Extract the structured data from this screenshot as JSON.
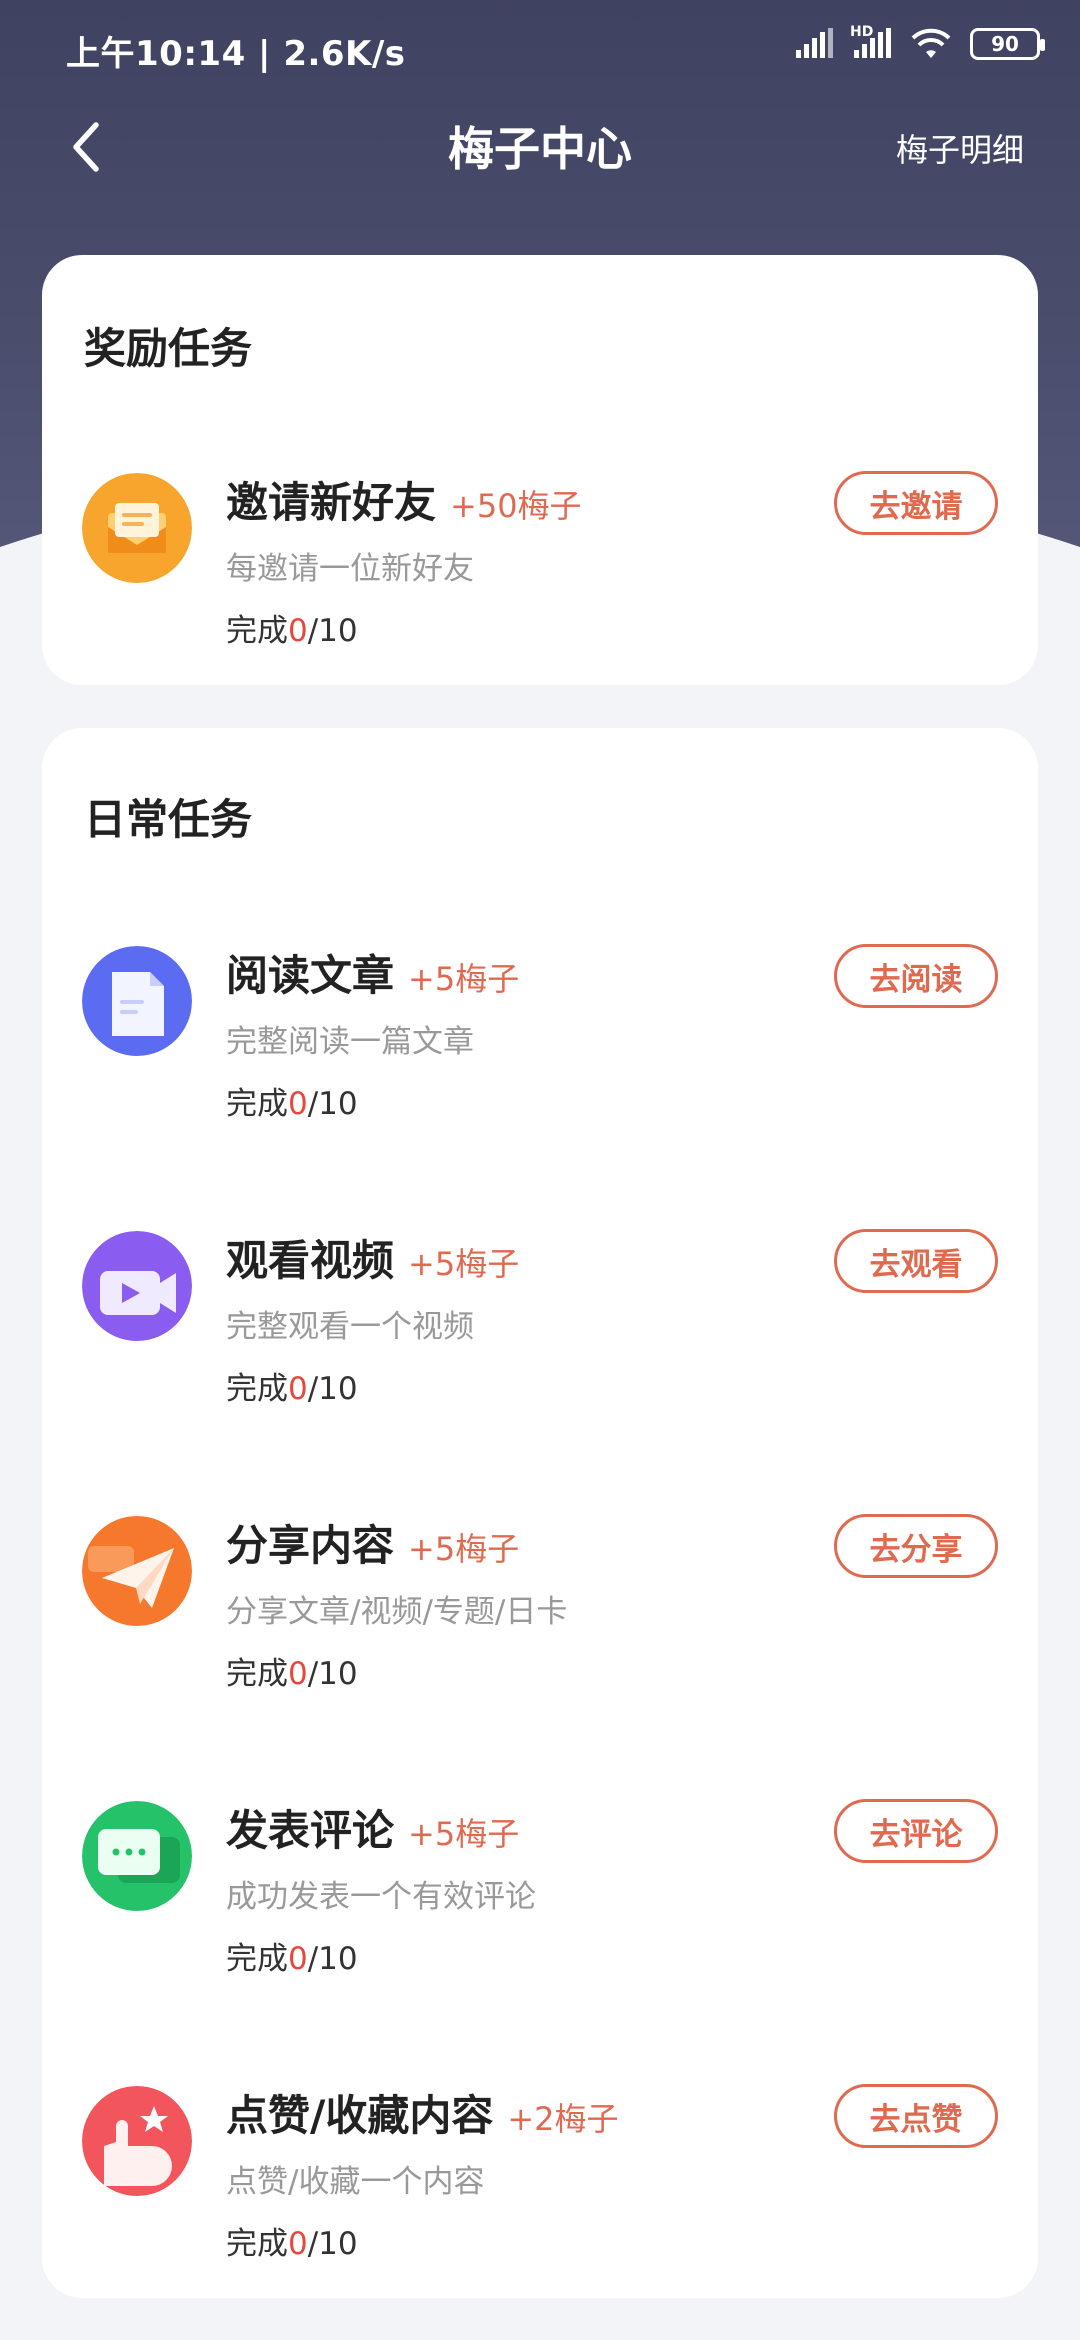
{
  "status_bar": {
    "time_speed": "上午10:14 | 2.6K/s",
    "hd": "HD",
    "battery": "90"
  },
  "nav": {
    "title": "梅子中心",
    "detail_link": "梅子明细"
  },
  "reward_section": {
    "title": "奖励任务",
    "tasks": [
      {
        "name": "邀请新好友",
        "reward": "+50梅子",
        "desc": "每邀请一位新好友",
        "progress_label": "完成",
        "progress_done": "0",
        "progress_total": "/10",
        "button": "去邀请",
        "icon": "envelope-icon",
        "color": "#f7a52c"
      }
    ]
  },
  "daily_section": {
    "title": "日常任务",
    "tasks": [
      {
        "name": "阅读文章",
        "reward": "+5梅子",
        "desc": "完整阅读一篇文章",
        "progress_label": "完成",
        "progress_done": "0",
        "progress_total": "/10",
        "button": "去阅读",
        "icon": "document-icon",
        "color": "#5b6bf2"
      },
      {
        "name": "观看视频",
        "reward": "+5梅子",
        "desc": "完整观看一个视频",
        "progress_label": "完成",
        "progress_done": "0",
        "progress_total": "/10",
        "button": "去观看",
        "icon": "video-icon",
        "color": "#8a5cf0"
      },
      {
        "name": "分享内容",
        "reward": "+5梅子",
        "desc": "分享文章/视频/专题/日卡",
        "progress_label": "完成",
        "progress_done": "0",
        "progress_total": "/10",
        "button": "去分享",
        "icon": "paper-plane-icon",
        "color": "#f5782c"
      },
      {
        "name": "发表评论",
        "reward": "+5梅子",
        "desc": "成功发表一个有效评论",
        "progress_label": "完成",
        "progress_done": "0",
        "progress_total": "/10",
        "button": "去评论",
        "icon": "comment-icon",
        "color": "#25c26a"
      },
      {
        "name": "点赞/收藏内容",
        "reward": "+2梅子",
        "desc": "点赞/收藏一个内容",
        "progress_label": "完成",
        "progress_done": "0",
        "progress_total": "/10",
        "button": "去点赞",
        "icon": "thumbs-up-star-icon",
        "color": "#f2555c"
      }
    ]
  },
  "colors": {
    "accent": "#e06a50",
    "progress_done": "#e5483d",
    "header_bg": "#45486a"
  }
}
